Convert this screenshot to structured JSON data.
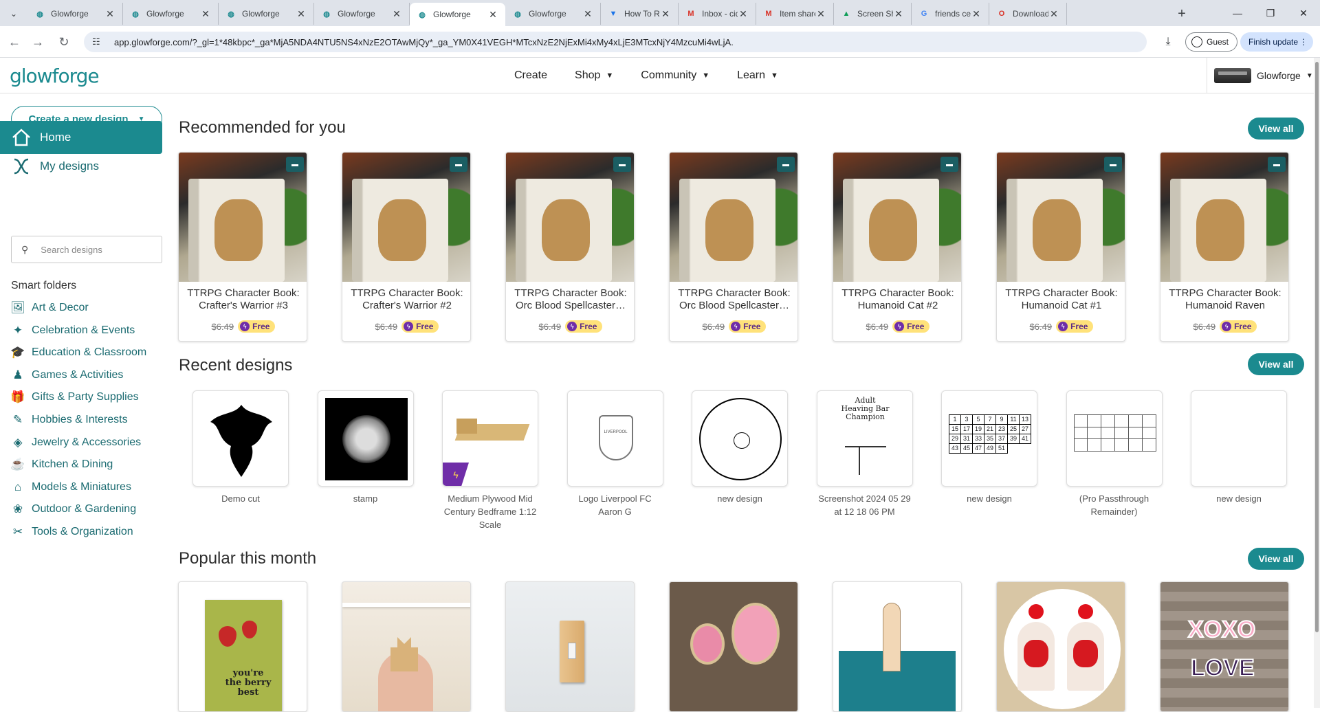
{
  "browser": {
    "tabs": [
      {
        "title": "Glowforge",
        "icon": "glowforge-icon"
      },
      {
        "title": "Glowforge",
        "icon": "glowforge-icon"
      },
      {
        "title": "Glowforge",
        "icon": "glowforge-icon"
      },
      {
        "title": "Glowforge",
        "icon": "glowforge-icon"
      },
      {
        "title": "Glowforge",
        "icon": "glowforge-icon",
        "active": true
      },
      {
        "title": "Glowforge",
        "icon": "glowforge-icon"
      },
      {
        "title": "How To Rem",
        "icon": "shield-icon"
      },
      {
        "title": "Inbox - cid@",
        "icon": "gmail-icon"
      },
      {
        "title": "Item shared",
        "icon": "gmail-icon"
      },
      {
        "title": "Screen Shot",
        "icon": "drive-icon"
      },
      {
        "title": "friends centr",
        "icon": "google-icon"
      },
      {
        "title": "Download y",
        "icon": "opera-icon"
      }
    ],
    "url": "app.glowforge.com/?_gl=1*48kbpc*_ga*MjA5NDA4NTU5NS4xNzE2OTAwMjQy*_ga_YM0X41VEGH*MTcxNzE2NjExMi4xMy4xLjE3MTcxNjY4MzcuMi4wLjA.",
    "guest_label": "Guest",
    "finish_update_label": "Finish update"
  },
  "header": {
    "logo": "glowforge",
    "nav": [
      "Create",
      "Shop",
      "Community",
      "Learn"
    ],
    "account_name": "Glowforge"
  },
  "sidebar": {
    "create_label": "Create a new design",
    "home_label": "Home",
    "my_designs_label": "My designs",
    "search_placeholder": "Search designs",
    "smart_folders_title": "Smart folders",
    "folders": [
      {
        "label": "Art & Decor",
        "icon": "art-icon"
      },
      {
        "label": "Celebration & Events",
        "icon": "celebration-icon"
      },
      {
        "label": "Education & Classroom",
        "icon": "education-icon"
      },
      {
        "label": "Games & Activities",
        "icon": "games-icon"
      },
      {
        "label": "Gifts & Party Supplies",
        "icon": "gift-icon"
      },
      {
        "label": "Hobbies & Interests",
        "icon": "hobbies-icon"
      },
      {
        "label": "Jewelry & Accessories",
        "icon": "jewelry-icon"
      },
      {
        "label": "Kitchen & Dining",
        "icon": "kitchen-icon"
      },
      {
        "label": "Models & Miniatures",
        "icon": "models-icon"
      },
      {
        "label": "Outdoor & Gardening",
        "icon": "outdoor-icon"
      },
      {
        "label": "Tools & Organization",
        "icon": "tools-icon"
      }
    ]
  },
  "recommended": {
    "title": "Recommended for you",
    "view_all": "View all",
    "items": [
      {
        "title": "TTRPG Character Book: Crafter's Warrior #3",
        "old_price": "$6.49",
        "price": "Free"
      },
      {
        "title": "TTRPG Character Book: Crafter's Warrior #2",
        "old_price": "$6.49",
        "price": "Free"
      },
      {
        "title": "TTRPG Character Book: Orc Blood Spellcaster…",
        "old_price": "$6.49",
        "price": "Free"
      },
      {
        "title": "TTRPG Character Book: Orc Blood Spellcaster…",
        "old_price": "$6.49",
        "price": "Free"
      },
      {
        "title": "TTRPG Character Book: Humanoid Cat #2",
        "old_price": "$6.49",
        "price": "Free"
      },
      {
        "title": "TTRPG Character Book: Humanoid Cat #1",
        "old_price": "$6.49",
        "price": "Free"
      },
      {
        "title": "TTRPG Character Book: Humanoid Raven",
        "old_price": "$6.49",
        "price": "Free"
      }
    ]
  },
  "recent": {
    "title": "Recent designs",
    "view_all": "View all",
    "items": [
      {
        "label": "Demo cut"
      },
      {
        "label": "stamp"
      },
      {
        "label": "Medium Plywood Mid Century Bedframe 1:12 Scale"
      },
      {
        "label": "Logo Liverpool FC Aaron G",
        "thumb_text": "LIVERPOOL"
      },
      {
        "label": "new design"
      },
      {
        "label": "Screenshot 2024 05 29 at 12 18 06 PM",
        "thumb_text": "Adult Heaving Bar Champion"
      },
      {
        "label": "new design",
        "calendar": [
          "1",
          "3",
          "5",
          "7",
          "9",
          "11",
          "13",
          "15",
          "17",
          "19",
          "21",
          "23",
          "25",
          "27",
          "29",
          "31",
          "33",
          "35",
          "37",
          "39",
          "41",
          "43",
          "45",
          "47",
          "49",
          "51"
        ]
      },
      {
        "label": "(Pro Passthrough Remainder)"
      },
      {
        "label": "new design"
      }
    ]
  },
  "popular": {
    "title": "Popular this month",
    "view_all": "View all",
    "card_text": {
      "berry": "you're the berry best",
      "xoxo": "XOXO",
      "love": "LOVE"
    }
  }
}
